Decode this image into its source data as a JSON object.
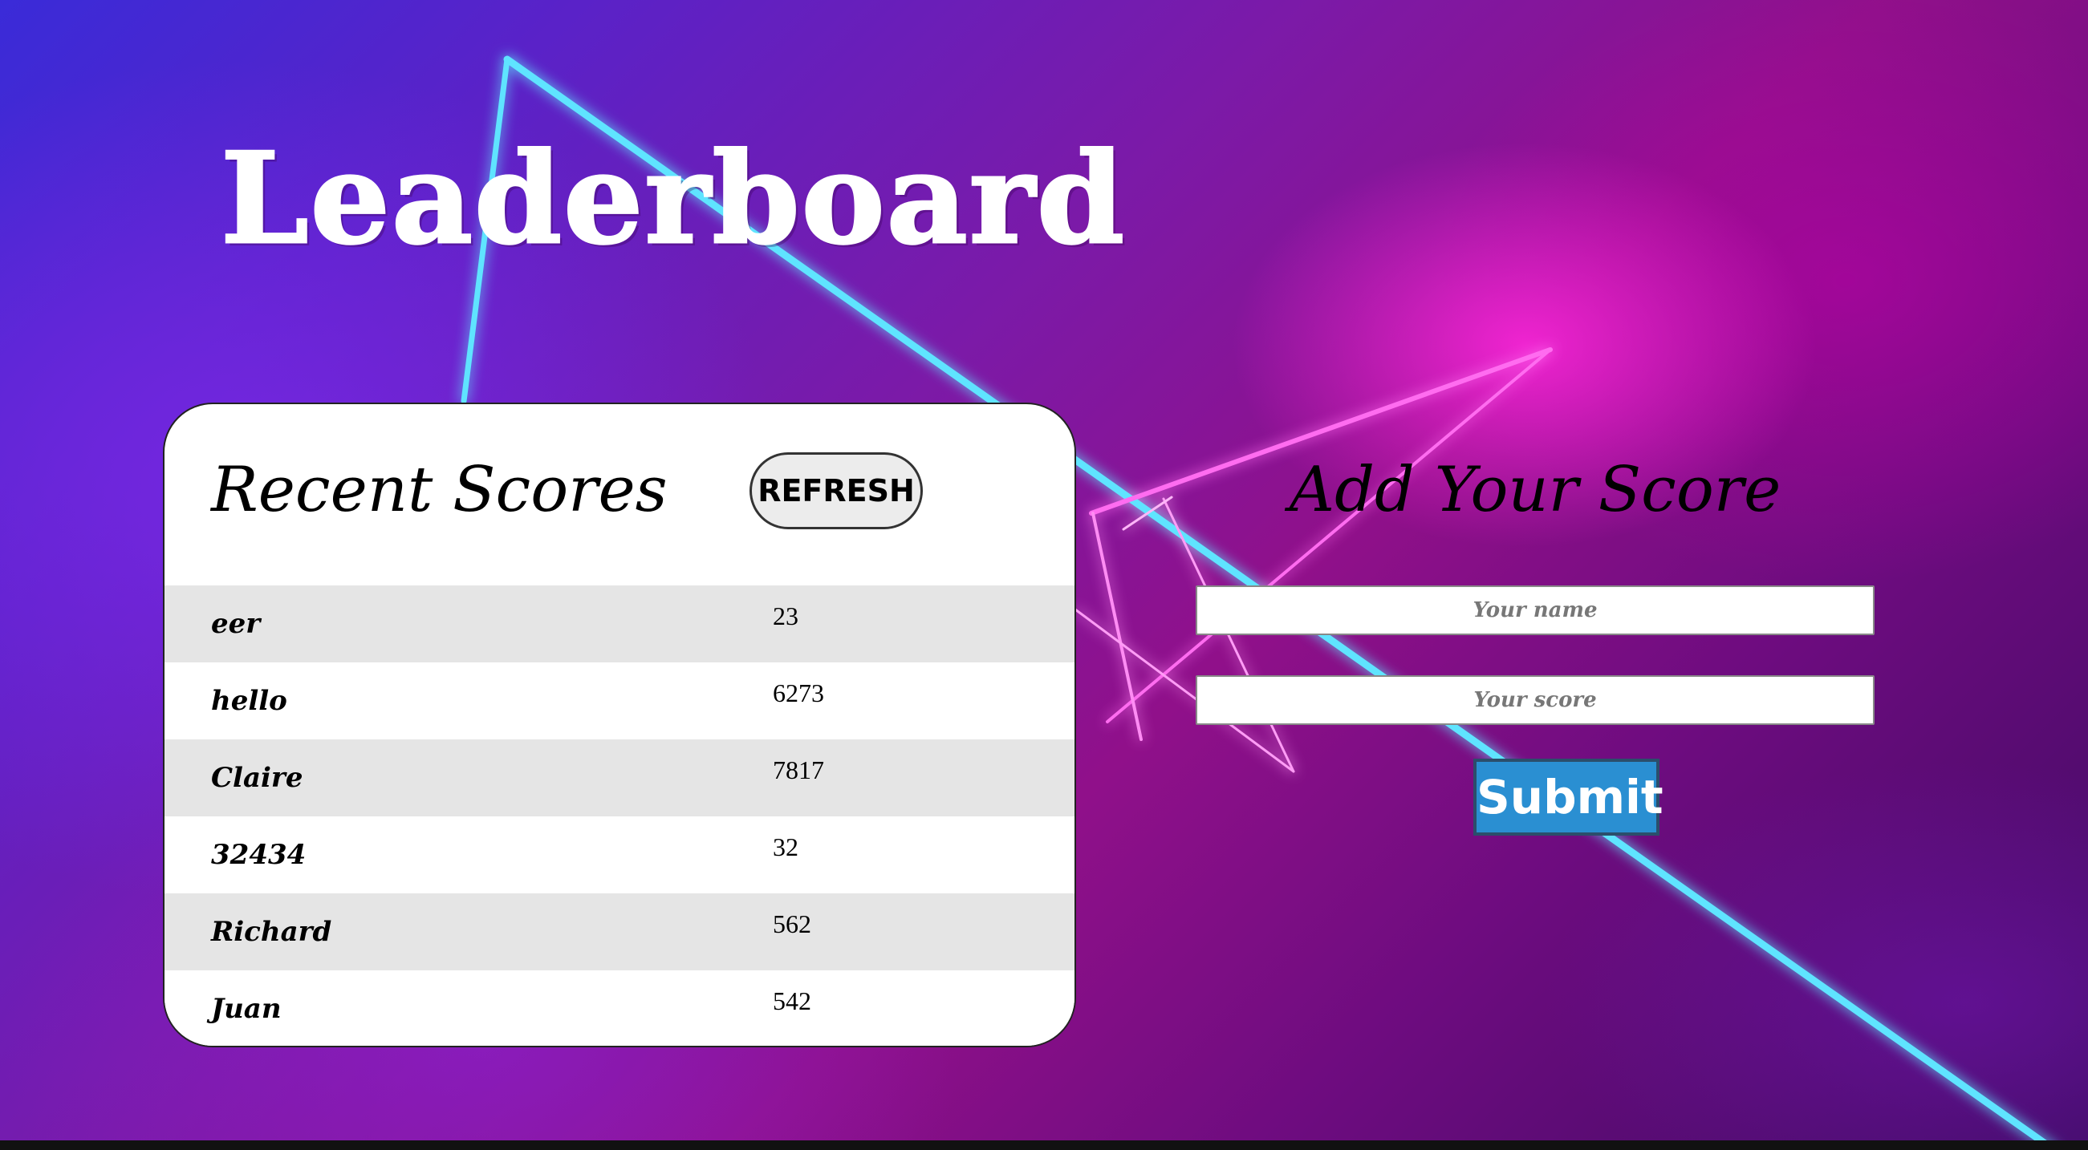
{
  "header": {
    "title": "Leaderboard"
  },
  "recent_scores": {
    "heading": "Recent Scores",
    "refresh_label": "REFRESH",
    "rows": [
      {
        "name": "eer",
        "score": "23"
      },
      {
        "name": "hello",
        "score": "6273"
      },
      {
        "name": "Claire",
        "score": "7817"
      },
      {
        "name": "32434",
        "score": "32"
      },
      {
        "name": "Richard",
        "score": "562"
      },
      {
        "name": "Juan",
        "score": "542"
      }
    ]
  },
  "add_score": {
    "heading": "Add Your Score",
    "name_placeholder": "Your name",
    "score_placeholder": "Your score",
    "submit_label": "Submit"
  },
  "colors": {
    "submit_button": "#2a8fd2",
    "row_stripe": "#e5e5e5",
    "neon_cyan": "#3fd8ff",
    "neon_pink": "#ff3ce0"
  }
}
